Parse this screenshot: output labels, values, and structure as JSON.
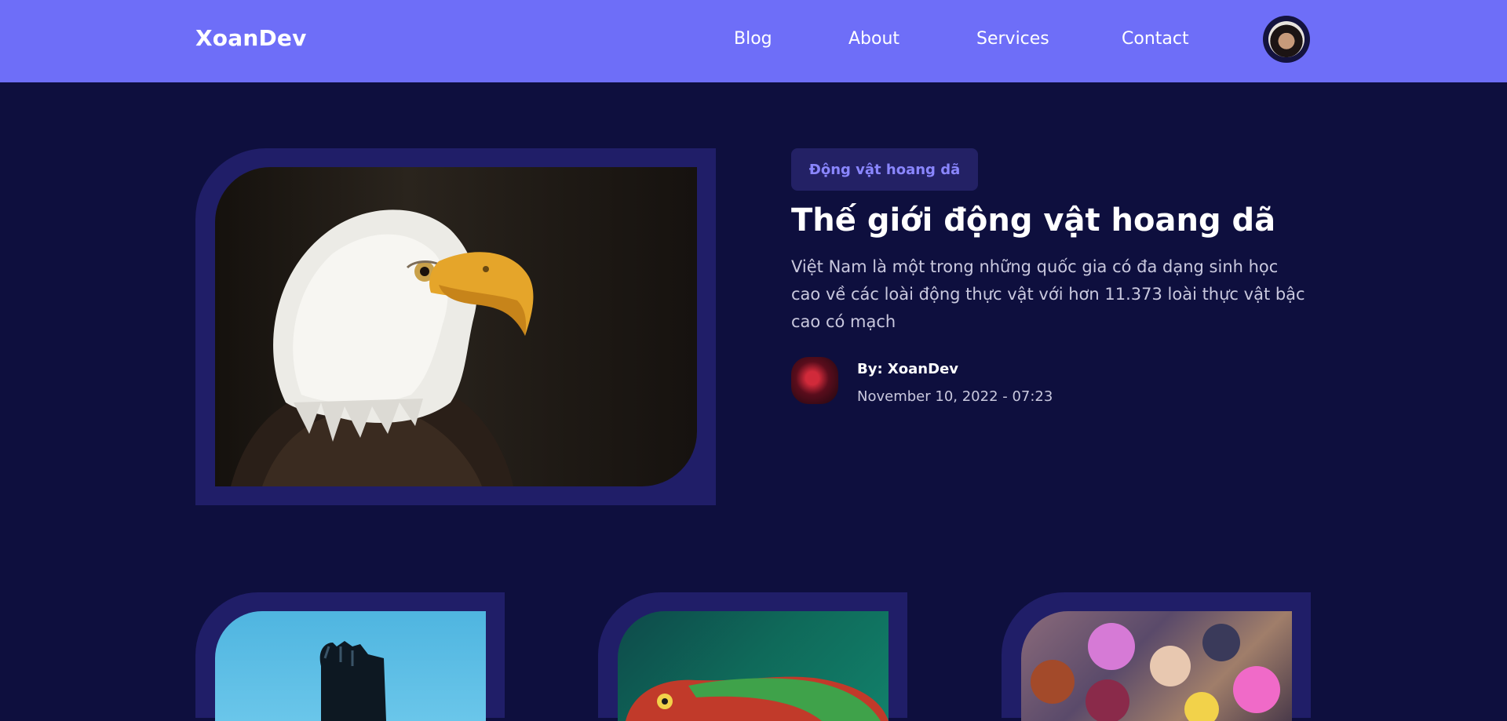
{
  "header": {
    "logo": "XoanDev",
    "nav": [
      "Blog",
      "About",
      "Services",
      "Contact"
    ]
  },
  "hero": {
    "tag": "Động vật hoang dã",
    "title": "Thế giới động vật hoang dã",
    "description": "Việt Nam là một trong những quốc gia có đa dạng sinh học cao về các loài động thực vật với hơn 11.373 loài thực vật bậc cao có mạch",
    "author": "By: XoanDev",
    "date": "November 10, 2022 - 07:23"
  },
  "colors": {
    "header_bg": "#6e6ef8",
    "page_bg": "#0e0f3e",
    "frame": "#201e68",
    "tag_bg": "#232165",
    "tag_text": "#8a86ff"
  },
  "icons": {
    "profile": "user-avatar",
    "author": "author-avatar"
  }
}
